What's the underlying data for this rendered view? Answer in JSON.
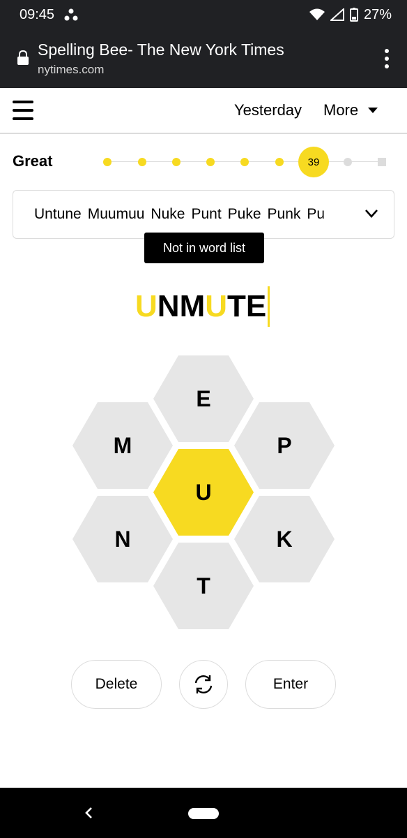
{
  "status_bar": {
    "time": "09:45",
    "battery": "27%"
  },
  "browser": {
    "title": "Spelling Bee- The New York Times",
    "domain": "nytimes.com"
  },
  "nav": {
    "yesterday": "Yesterday",
    "more": "More"
  },
  "progress": {
    "rank": "Great",
    "score": "39",
    "level_index": 6,
    "level_count": 9
  },
  "found_words": [
    "Untune",
    "Muumuu",
    "Nuke",
    "Punt",
    "Puke",
    "Punk",
    "Pu"
  ],
  "toast": "Not in word list",
  "input_word": [
    {
      "char": "U",
      "highlight": true
    },
    {
      "char": "N",
      "highlight": false
    },
    {
      "char": "M",
      "highlight": false
    },
    {
      "char": "U",
      "highlight": true
    },
    {
      "char": "T",
      "highlight": false
    },
    {
      "char": "E",
      "highlight": false
    }
  ],
  "hive": {
    "center": "U",
    "top": "E",
    "upper_left": "M",
    "upper_right": "P",
    "lower_left": "N",
    "lower_right": "K",
    "bottom": "T"
  },
  "buttons": {
    "delete": "Delete",
    "enter": "Enter"
  },
  "colors": {
    "accent": "#f7da21",
    "hex_outer": "#e6e6e6",
    "chrome": "#202124"
  }
}
